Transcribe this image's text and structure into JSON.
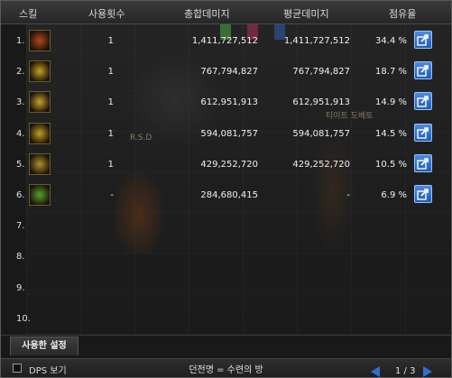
{
  "header": {
    "skill": "스킬",
    "uses": "사용횟수",
    "total_damage": "총합데미지",
    "avg_damage": "평균데미지",
    "share": "점유율"
  },
  "rows": [
    {
      "num": "1.",
      "uses": "1",
      "total": "1,411,727,512",
      "avg": "1,411,727,512",
      "share": "34.4 %",
      "icon": "flame-claw-skill-icon",
      "color": "#b8441c"
    },
    {
      "num": "2.",
      "uses": "1",
      "total": "767,794,827",
      "avg": "767,794,827",
      "share": "18.7 %",
      "icon": "sword-slash-skill-icon",
      "color": "#c9a020"
    },
    {
      "num": "3.",
      "uses": "1",
      "total": "612,951,913",
      "avg": "612,951,913",
      "share": "14.9 %",
      "icon": "orbit-ring-skill-icon",
      "color": "#c8a030"
    },
    {
      "num": "4.",
      "uses": "1",
      "total": "594,081,757",
      "avg": "594,081,757",
      "share": "14.5 %",
      "icon": "spiral-e-skill-icon",
      "color": "#c0a020"
    },
    {
      "num": "5.",
      "uses": "1",
      "total": "429,252,720",
      "avg": "429,252,720",
      "share": "10.5 %",
      "icon": "wave-slash-skill-icon",
      "color": "#b0902a"
    },
    {
      "num": "6.",
      "uses": "-",
      "total": "284,680,415",
      "avg": "-",
      "share": "6.9 %",
      "icon": "rune-glyph-skill-icon",
      "color": "#5aa030"
    },
    {
      "num": "7."
    },
    {
      "num": "8."
    },
    {
      "num": "9."
    },
    {
      "num": "10."
    }
  ],
  "scene": {
    "label1": "R.S.D",
    "label2": "티이트 도베토"
  },
  "tab_label": "사용한 설정",
  "footer": {
    "dps_toggle": "DPS 보기",
    "dungeon": "던전명 = 수련의 방",
    "page": "1 / 3"
  }
}
